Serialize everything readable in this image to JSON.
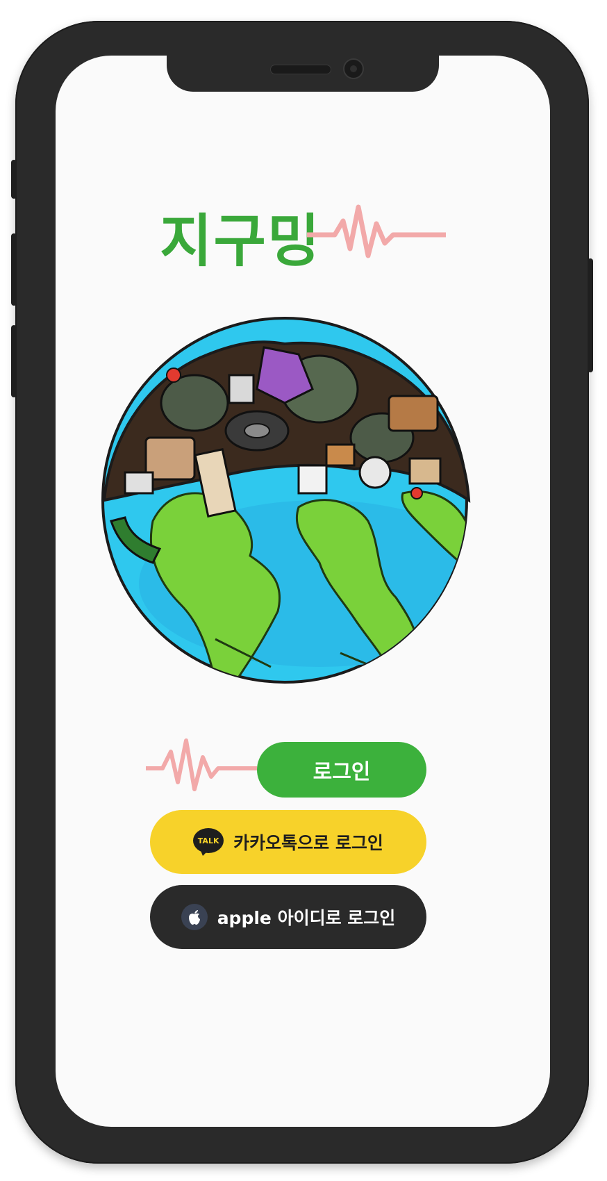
{
  "app": {
    "title": "지구밍"
  },
  "buttons": {
    "login_label": "로그인",
    "kakao_label": "카카오톡으로 로그인",
    "kakao_badge": "TALK",
    "apple_label": "apple 아이디로 로그인"
  },
  "colors": {
    "brand_green": "#3cb13c",
    "pulse_pink": "#f2a9a9",
    "kakao_yellow": "#f7d22a",
    "apple_dark": "#2a2a2a"
  },
  "icons": {
    "title_decoration": "heartbeat-line-icon",
    "login_decoration": "heartbeat-line-icon",
    "kakao": "kakao-talk-icon",
    "apple": "apple-logo-icon",
    "illustration": "earth-with-trash-illustration"
  }
}
